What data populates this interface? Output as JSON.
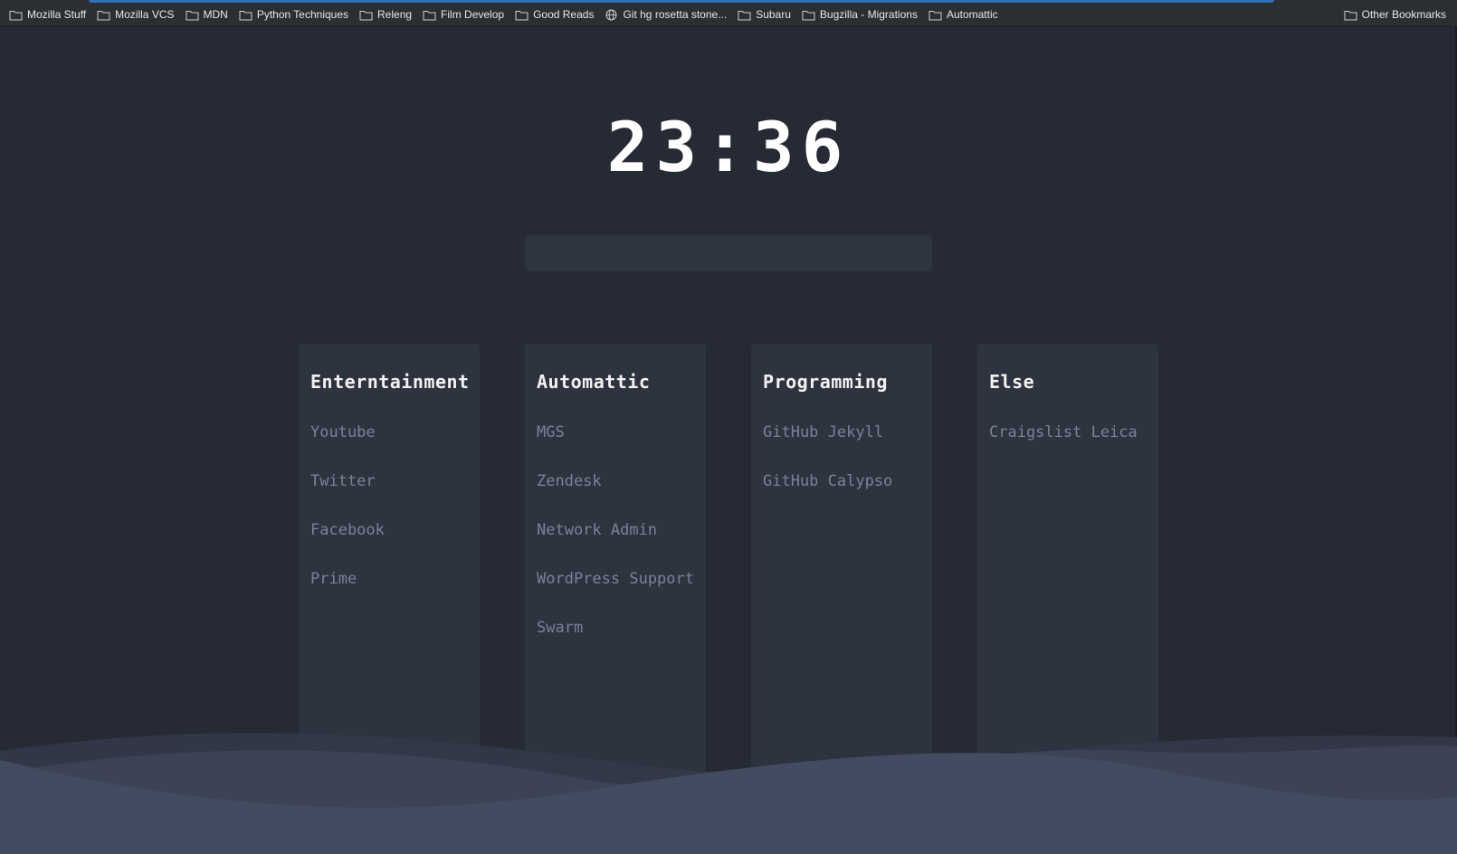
{
  "bookmarks": {
    "items": [
      {
        "label": "Mozilla Stuff",
        "icon": "folder-icon"
      },
      {
        "label": "Mozilla VCS",
        "icon": "folder-icon"
      },
      {
        "label": "MDN",
        "icon": "folder-icon"
      },
      {
        "label": "Python Techniques",
        "icon": "folder-icon"
      },
      {
        "label": "Releng",
        "icon": "folder-icon"
      },
      {
        "label": "Film Develop",
        "icon": "folder-icon"
      },
      {
        "label": "Good Reads",
        "icon": "folder-icon"
      },
      {
        "label": "Git hg rosetta stone...",
        "icon": "globe-icon"
      },
      {
        "label": "Subaru",
        "icon": "folder-icon"
      },
      {
        "label": "Bugzilla - Migrations",
        "icon": "folder-icon"
      },
      {
        "label": "Automattic",
        "icon": "folder-icon"
      }
    ],
    "other": {
      "label": "Other Bookmarks",
      "icon": "folder-icon"
    }
  },
  "clock": {
    "time": "23:36"
  },
  "search": {
    "value": "",
    "placeholder": ""
  },
  "cards": [
    {
      "title": "Enterntainment",
      "links": [
        "Youtube",
        "Twitter",
        "Facebook",
        "Prime"
      ]
    },
    {
      "title": "Automattic",
      "links": [
        "MGS",
        "Zendesk",
        "Network Admin",
        "WordPress Support",
        "Swarm"
      ]
    },
    {
      "title": "Programming",
      "links": [
        "GitHub Jekyll",
        "GitHub Calypso"
      ]
    },
    {
      "title": "Else",
      "links": [
        "Craigslist Leica"
      ]
    }
  ],
  "colors": {
    "background": "#262a35",
    "card": "#2e3340",
    "link": "#7d8293",
    "title": "#f2f2f2",
    "wave": "#434b60"
  }
}
